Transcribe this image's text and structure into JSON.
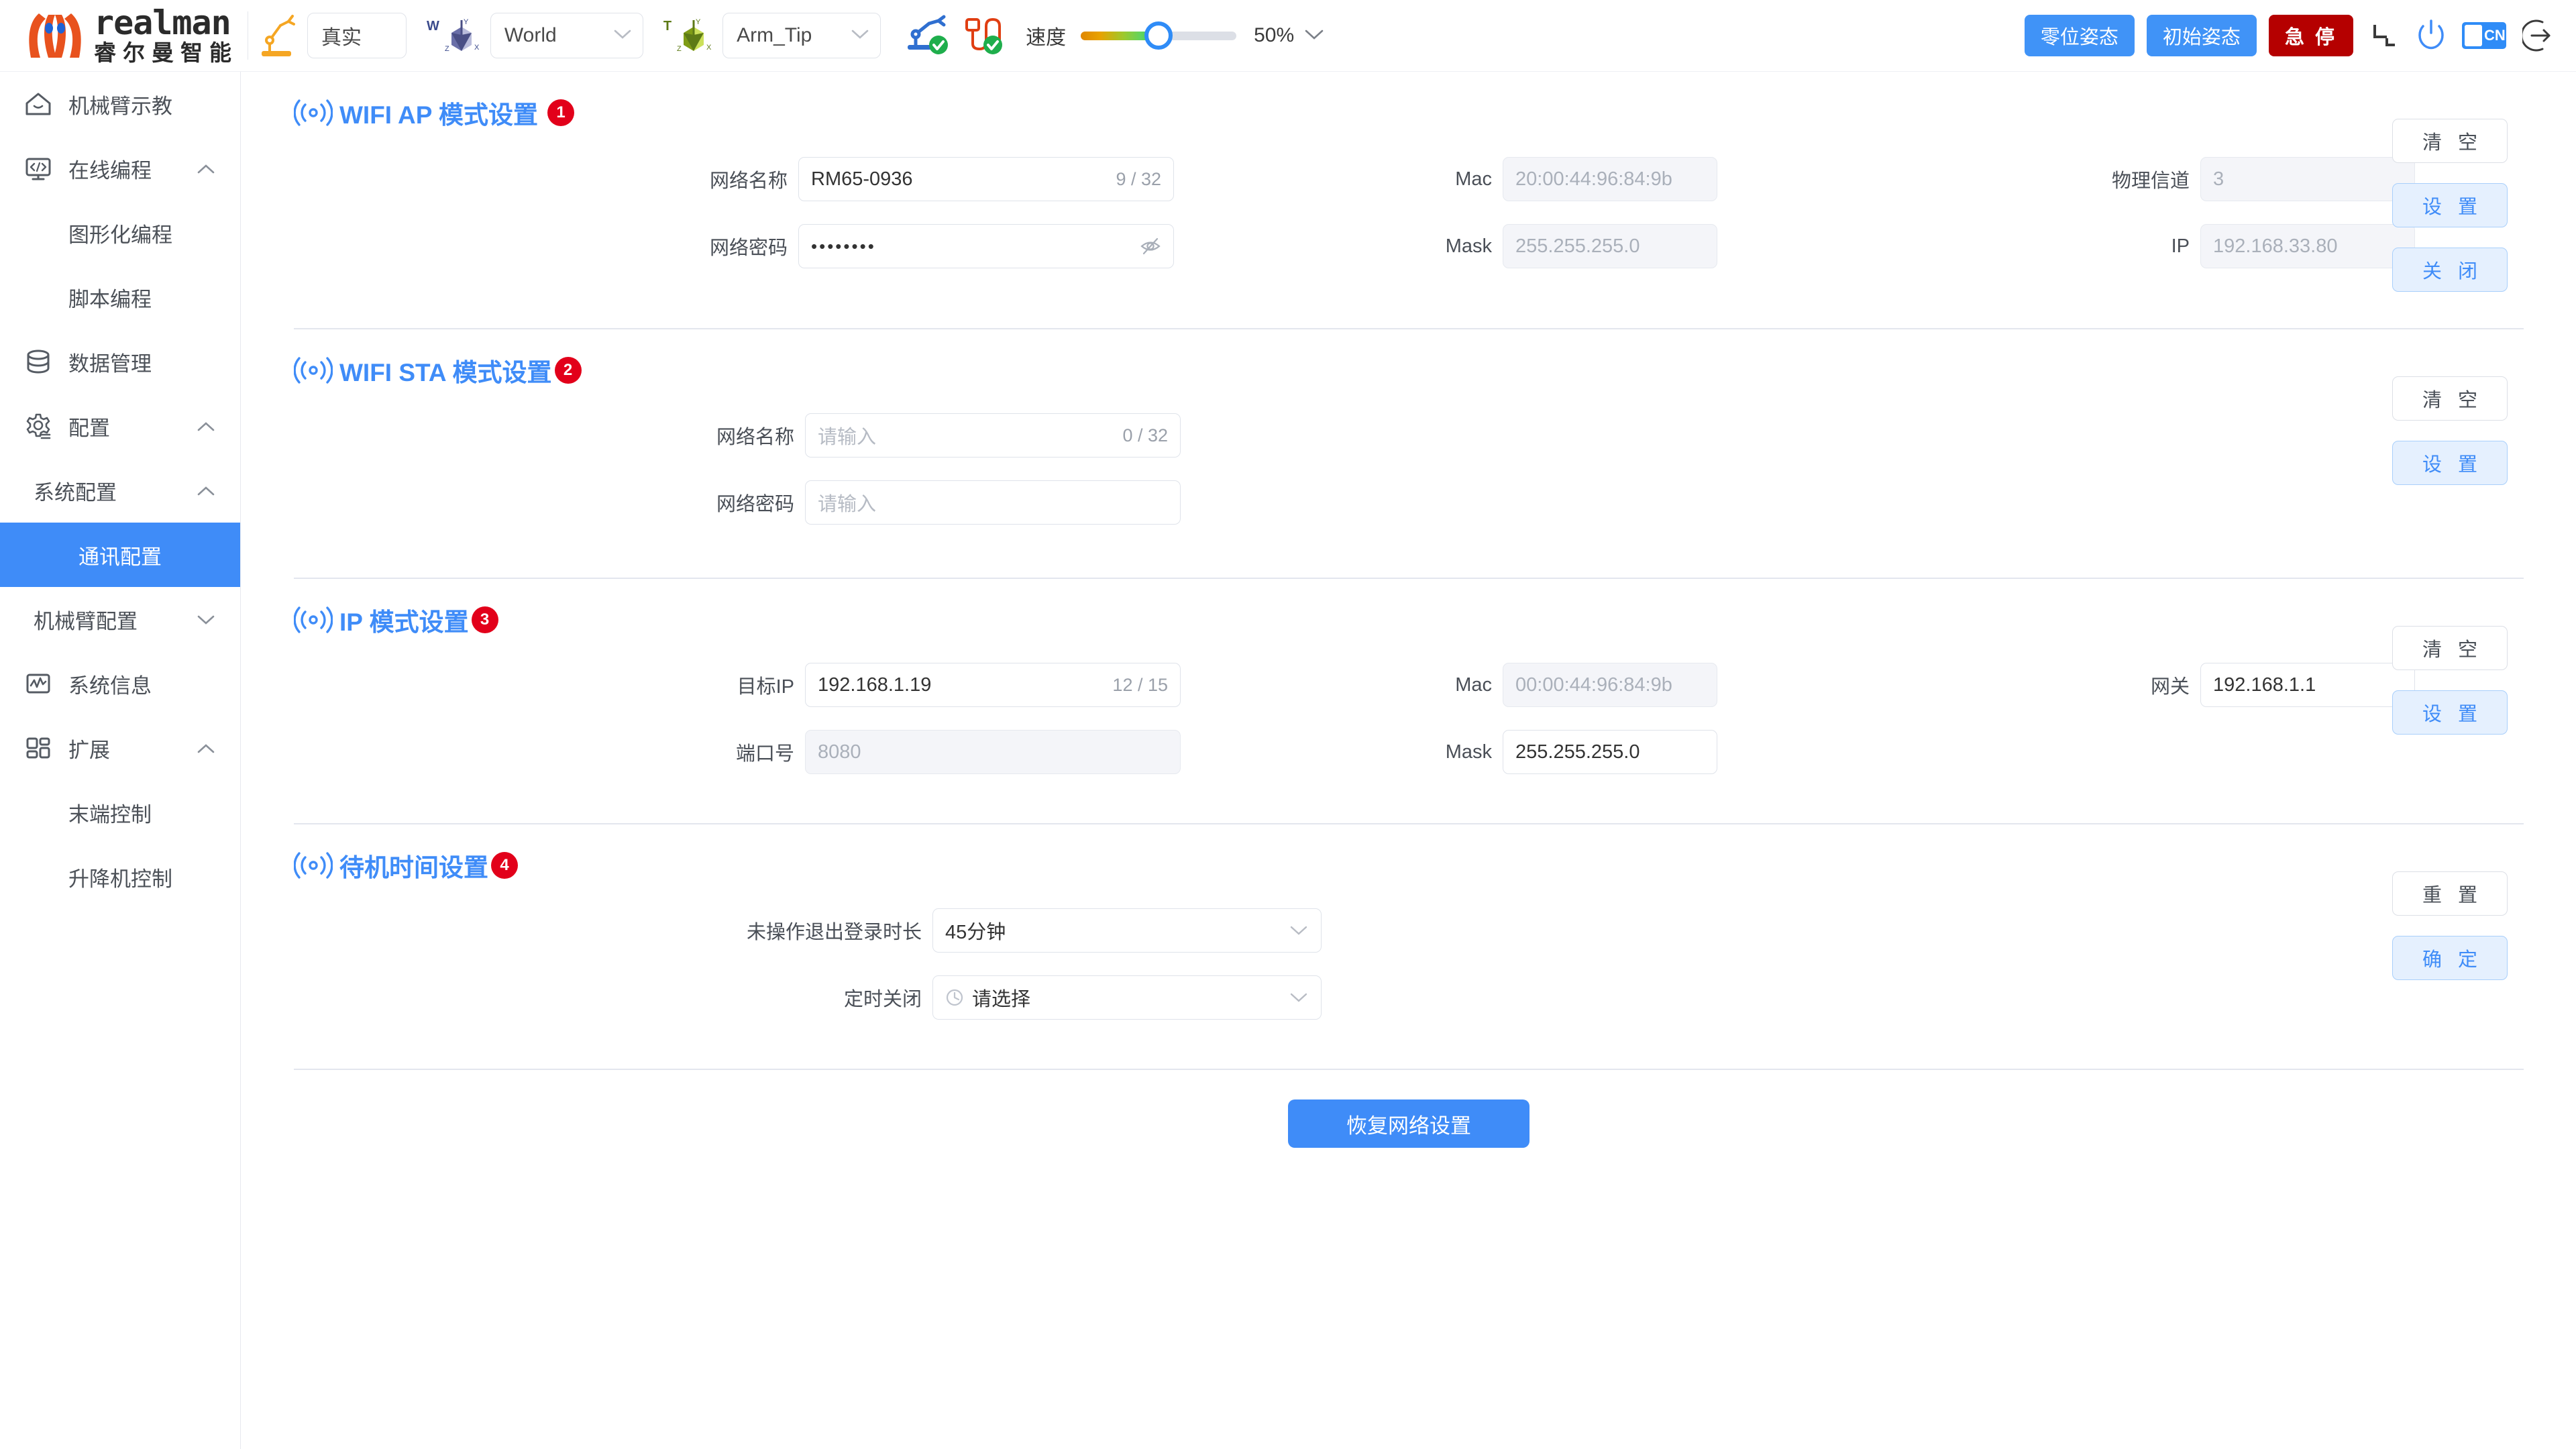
{
  "brand": {
    "name_en": "realman",
    "name_cn": "睿尔曼智能"
  },
  "toolbar": {
    "mode_label": "真实",
    "robot_arm_icon": "robot-arm-icon",
    "frame_tag": "W",
    "frame_value": "World",
    "tool_tag": "T",
    "tool_value": "Arm_Tip",
    "status_arm_icon": "arm-connected-icon",
    "status_cable_icon": "cable-connected-icon",
    "speed_label": "速度",
    "speed_value": "50%",
    "speed_percent": 50,
    "zero_pose": "零位姿态",
    "init_pose": "初始姿态",
    "estop": "急 停",
    "collapse_icon": "collapse-icon",
    "power_icon": "power-icon",
    "lang_code": "CN",
    "logout_icon": "logout-icon"
  },
  "sidebar": {
    "items": [
      {
        "label": "机械臂示教",
        "icon": "home-icon",
        "type": "item",
        "arrow": ""
      },
      {
        "label": "在线编程",
        "icon": "code-icon",
        "type": "item",
        "arrow": "up"
      },
      {
        "label": "图形化编程",
        "type": "sub"
      },
      {
        "label": "脚本编程",
        "type": "sub"
      },
      {
        "label": "数据管理",
        "icon": "database-icon",
        "type": "item",
        "arrow": ""
      },
      {
        "label": "配置",
        "icon": "gear-icon",
        "type": "item",
        "arrow": "up"
      },
      {
        "label": "系统配置",
        "type": "group",
        "arrow": "up"
      },
      {
        "label": "通讯配置",
        "type": "sub",
        "active": true
      },
      {
        "label": "机械臂配置",
        "type": "group",
        "arrow": "down"
      },
      {
        "label": "系统信息",
        "icon": "chart-icon",
        "type": "item",
        "arrow": ""
      },
      {
        "label": "扩展",
        "icon": "grid-icon",
        "type": "item",
        "arrow": "up"
      },
      {
        "label": "末端控制",
        "type": "sub"
      },
      {
        "label": "升降机控制",
        "type": "sub"
      }
    ]
  },
  "sections": {
    "wifi_ap": {
      "title": "WIFI AP 模式设置",
      "badge": "1",
      "fields": {
        "ssid_label": "网络名称",
        "ssid_value": "RM65-0936",
        "ssid_count": "9 / 32",
        "password_label": "网络密码",
        "password_value": "••••••••",
        "mac_label": "Mac",
        "mac_value": "20:00:44:96:84:9b",
        "mask_label": "Mask",
        "mask_value": "255.255.255.0",
        "channel_label": "物理信道",
        "channel_value": "3",
        "ip_label": "IP",
        "ip_value": "192.168.33.80"
      },
      "buttons": {
        "clear": "清 空",
        "set": "设 置",
        "close": "关 闭"
      }
    },
    "wifi_sta": {
      "title": "WIFI STA 模式设置",
      "badge": "2",
      "fields": {
        "ssid_label": "网络名称",
        "ssid_placeholder": "请输入",
        "ssid_count": "0 / 32",
        "password_label": "网络密码",
        "password_placeholder": "请输入"
      },
      "buttons": {
        "clear": "清 空",
        "set": "设 置"
      }
    },
    "ip_mode": {
      "title": "IP 模式设置",
      "badge": "3",
      "fields": {
        "target_ip_label": "目标IP",
        "target_ip_value": "192.168.1.19",
        "target_ip_count": "12 / 15",
        "port_label": "端口号",
        "port_value": "8080",
        "mac_label": "Mac",
        "mac_value": "00:00:44:96:84:9b",
        "mask_label": "Mask",
        "mask_value": "255.255.255.0",
        "gateway_label": "网关",
        "gateway_value": "192.168.1.1"
      },
      "buttons": {
        "clear": "清 空",
        "set": "设 置"
      }
    },
    "standby": {
      "title": "待机时间设置",
      "badge": "4",
      "fields": {
        "logout_label": "未操作退出登录时长",
        "logout_value": "45分钟",
        "shutdown_label": "定时关闭",
        "shutdown_placeholder": "请选择"
      },
      "buttons": {
        "reset": "重 置",
        "confirm": "确 定"
      }
    }
  },
  "footer": {
    "restore_label": "恢复网络设置"
  },
  "colors": {
    "accent": "#3f8cf8",
    "danger": "#b50000",
    "badge": "#e2001a",
    "logo_orange": "#e8521e"
  }
}
